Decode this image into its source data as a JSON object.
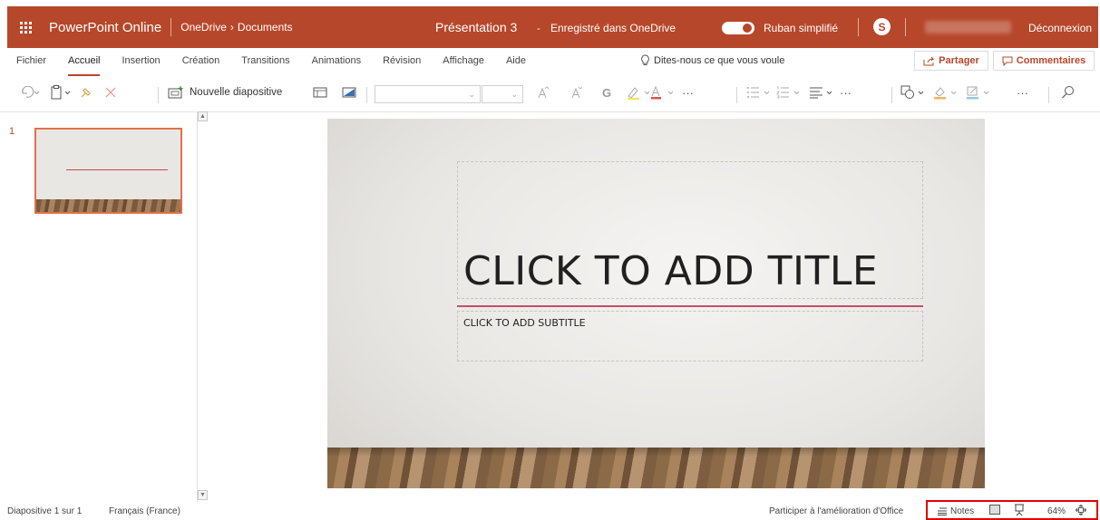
{
  "topbar": {
    "app_name": "PowerPoint Online",
    "breadcrumb_root": "OneDrive",
    "breadcrumb_sep": "›",
    "breadcrumb_folder": "Documents",
    "doc_title": "Présentation 3",
    "doc_dash": "-",
    "doc_saved": "Enregistré dans OneDrive",
    "simplified_ribbon_label": "Ruban simplifié",
    "simplified_ribbon_on": true,
    "skype_letter": "S",
    "logout_label": "Déconnexion"
  },
  "ribbon": {
    "tabs": [
      "Fichier",
      "Accueil",
      "Insertion",
      "Création",
      "Transitions",
      "Animations",
      "Révision",
      "Affichage",
      "Aide"
    ],
    "active_tab": "Accueil",
    "tell_me": "Dites-nous ce que vous voule",
    "share_label": "Partager",
    "comments_label": "Commentaires"
  },
  "toolbar": {
    "new_slide_label": "Nouvelle diapositive",
    "font_name_value": "",
    "font_size_value": "",
    "bold_glyph": "G",
    "more_glyph": "···"
  },
  "thumbnails": {
    "slide_number": "1"
  },
  "slide": {
    "title_placeholder": "CLICK TO ADD TITLE",
    "subtitle_placeholder": "CLICK TO ADD SUBTITLE"
  },
  "statusbar": {
    "slide_info": "Diapositive 1 sur 1",
    "language": "Français (France)",
    "improve": "Participer à l'amélioration d'Office",
    "notes_label": "Notes",
    "zoom": "64%"
  },
  "colors": {
    "brand": "#b7472a",
    "highlight": "#e00000"
  }
}
